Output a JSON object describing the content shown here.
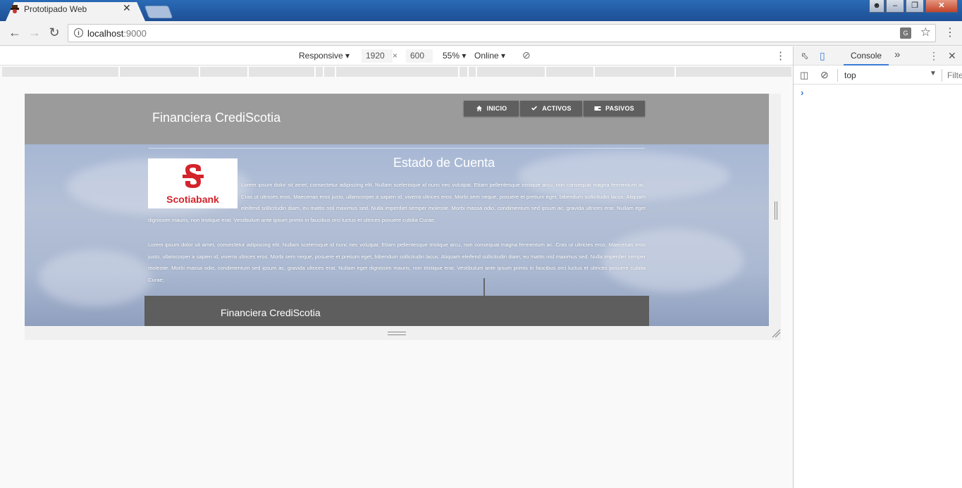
{
  "browser": {
    "tab_title": "Prototipado Web",
    "tab_close": "✕",
    "url_host": "localhost",
    "url_port": ":9000",
    "window_controls": [
      "user",
      "minimize",
      "maximize",
      "close"
    ]
  },
  "device_toolbar": {
    "mode": "Responsive",
    "width": "1920",
    "times": "×",
    "height": "600",
    "zoom": "55%",
    "network": "Online"
  },
  "site": {
    "brand": "Financiera CrediScotia",
    "nav": [
      {
        "label": "INICIO",
        "icon": "home-icon"
      },
      {
        "label": "ACTIVOS",
        "icon": "check-icon"
      },
      {
        "label": "PASIVOS",
        "icon": "wallet-icon"
      }
    ],
    "page_title": "Estado de Cuenta",
    "logo_text": "Scotiabank",
    "paragraph1": "Lorem ipsum dolor sit amet, consectetur adipiscing elit. Nullam scelerisque id nunc nec volutpat. Etiam pellentesque tristique arcu, non consequat magna fermentum ac. Cras ut ultricies eros. Maecenas eros justo, ullamcorper a sapien id, viverra ultrices eros. Morbi sem neque, posuere et pretium eget, bibendum sollicitudin lacus. Aliquam eleifend sollicitudin diam, eu mattis nisl maximus sed. Nulla imperdiet semper molestie. Morbi massa odio, condimentum sed ipsum ac, gravida ultrices erat. Nullam eget dignissim mauris, non tristique erat. Vestibulum ante ipsum primis in faucibus orci luctus et ultrices posuere cubilia Curae;",
    "paragraph2": "Lorem ipsum dolor sit amet, consectetur adipiscing elit. Nullam scelerisque id nunc nec volutpat. Etiam pellentesque tristique arcu, non consequat magna fermentum ac. Cras ut ultricies eros. Maecenas eros justo, ullamcorper a sapien id, viverra ultrices eros. Morbi sem neque, posuere et pretium eget, bibendum sollicitudin lacus. Aliquam eleifend sollicitudin diam, eu mattis nisl maximus sed. Nulla imperdiet semper molestie. Morbi massa odio, condimentum sed ipsum ac, gravida ultrices erat. Nullam eget dignissim mauris, non tristique erat. Vestibulum ante ipsum primis in faucibus orci luctus et ultrices posuere cubilia Curae;",
    "footer_brand": "Financiera CrediScotia"
  },
  "devtools": {
    "tab": "Console",
    "more_tabs": "»",
    "context": "top",
    "filter_placeholder": "Filter",
    "prompt": "›"
  },
  "colors": {
    "header_bg": "#9b9b9b",
    "nav_btn_bg": "#5f5f5f",
    "footer_bg": "#5e5e5e",
    "brand_red": "#d3232b",
    "devtools_accent": "#3b7bd6"
  }
}
